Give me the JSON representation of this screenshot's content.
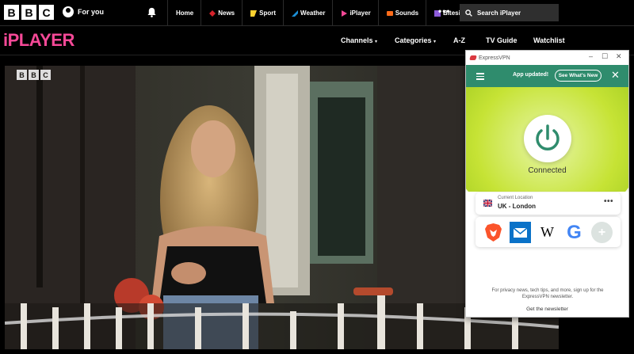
{
  "bbc_header": {
    "logo_letters": [
      "B",
      "B",
      "C"
    ],
    "for_you_label": "For you",
    "nav_items": [
      {
        "label": "Home",
        "icon": "none",
        "color": "#ffffff"
      },
      {
        "label": "News",
        "icon": "news-icon",
        "color": "#d7222b"
      },
      {
        "label": "Sport",
        "icon": "sport-icon",
        "color": "#ffd230"
      },
      {
        "label": "Weather",
        "icon": "weather-icon",
        "color": "#1c8fd6"
      },
      {
        "label": "iPlayer",
        "icon": "iplayer-icon",
        "color": "#f54997"
      },
      {
        "label": "Sounds",
        "icon": "sounds-icon",
        "color": "#ff6c1a"
      },
      {
        "label": "Bitesize",
        "icon": "bitesize-icon",
        "color": "#8d5cdb"
      }
    ],
    "more_label": "•••",
    "search_placeholder": "Search iPlayer"
  },
  "iplayer_bar": {
    "logo": "iPLAYER",
    "logo_color": "#f54997",
    "menu": [
      {
        "label": "Channels",
        "dropdown": true
      },
      {
        "label": "Categories",
        "dropdown": true
      },
      {
        "label": "A-Z",
        "dropdown": false
      },
      {
        "label": "TV Guide",
        "dropdown": false
      },
      {
        "label": "Watchlist",
        "dropdown": false
      }
    ]
  },
  "video": {
    "watermark_letters": [
      "B",
      "B",
      "C"
    ]
  },
  "vpn": {
    "window_title": "ExpressVPN",
    "window_controls": [
      "–",
      "☐",
      "✕"
    ],
    "update_text": "App updated!",
    "whats_new_label": "See What's New",
    "status": "Connected",
    "accent_color": "#2f8c6d",
    "hero_color": "#c6e335",
    "location_label": "Current Location",
    "location_value": "UK - London",
    "location_more": "•••",
    "shortcuts": [
      "brave-icon",
      "mail-icon",
      "wikipedia-icon",
      "google-icon",
      "add-shortcut-icon"
    ],
    "wikipedia_letter": "W",
    "google_letter": "G",
    "add_symbol": "+",
    "newsletter_text": "For privacy news, tech tips, and more, sign up for the ExpressVPN newsletter.",
    "newsletter_link": "Get the newsletter"
  }
}
